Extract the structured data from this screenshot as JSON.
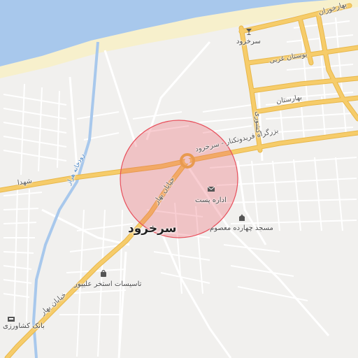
{
  "map": {
    "colors": {
      "sea": "#a8c8ec",
      "beach": "#f7f0cc",
      "land": "#f1f0ee",
      "major_road": "#f6cc6a",
      "minor_road": "#ffffff",
      "river": "#a8c8ec",
      "accuracy_circle": "#e8505c"
    },
    "labels": {
      "town": "سرخرود",
      "main_road": "بزرگراه فریدونکنار - سرخرود",
      "shohada": "شهدا",
      "river": "رودخانه هراز",
      "khiaban_bahar_1": "خیابان بهار",
      "khiaban_bahar_2": "خیابان بهار",
      "post_office": "اداره پست",
      "mosque": "مسجد چهارده معصوم",
      "pool": "تاسیسات استخر علیپور",
      "bank": "بانک کشاورزی",
      "bar": "سرخرود",
      "bostan_gharbi": "بوستان غربی",
      "baharestan": "بهارستان",
      "bahar_khoran": "بهارخوران",
      "keshvari": "کشوری"
    },
    "icons": {
      "bar": "cocktail-icon",
      "post_office": "envelope-icon",
      "mosque": "mosque-icon",
      "pool": "bag-icon",
      "bank": "atm-icon"
    }
  }
}
